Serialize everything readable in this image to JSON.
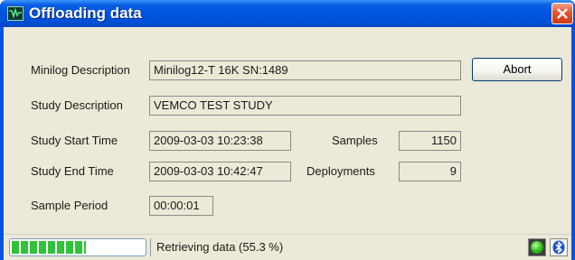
{
  "window": {
    "title": "Offloading data",
    "app_icon": "oscilloscope-icon",
    "close_icon": "close-icon"
  },
  "form": {
    "minilog_description_label": "Minilog Description",
    "minilog_description_value": "Minilog12-T 16K SN:1489",
    "study_description_label": "Study Description",
    "study_description_value": "VEMCO TEST STUDY",
    "study_start_time_label": "Study Start Time",
    "study_start_time_value": "2009-03-03 10:23:38",
    "study_end_time_label": "Study End Time",
    "study_end_time_value": "2009-03-03 10:42:47",
    "sample_period_label": "Sample Period",
    "sample_period_value": "00:00:01",
    "samples_label": "Samples",
    "samples_value": "1150",
    "deployments_label": "Deployments",
    "deployments_value": "9",
    "abort_label": "Abort"
  },
  "status": {
    "progress_fraction": 0.553,
    "text": "Retrieving data (55.3 %)",
    "indicator_icon": "green-led-icon",
    "bluetooth_icon": "bluetooth-icon",
    "progress_color": "#2fc33a"
  }
}
